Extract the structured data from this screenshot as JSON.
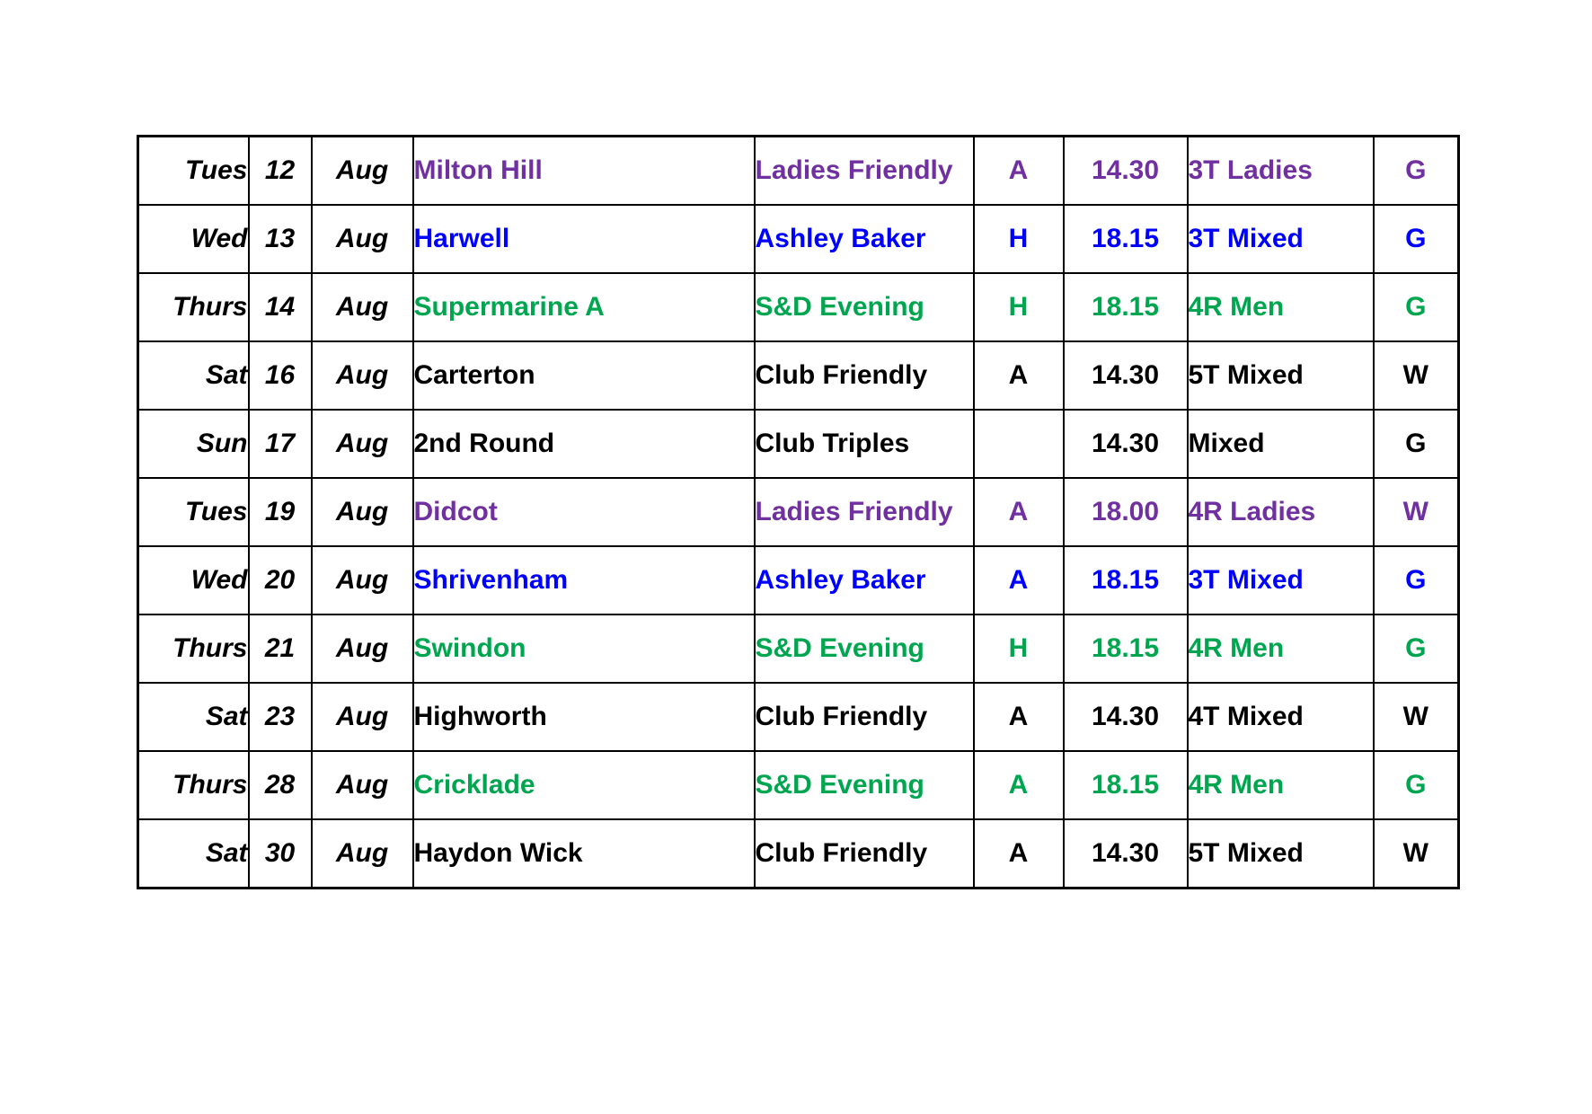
{
  "document": {
    "kind": "fixtures-table",
    "background": "#FFFFFF"
  },
  "palette": {
    "purple": "#7030A0",
    "blue": "#0000FF",
    "green": "#00A64F",
    "black": "#000000",
    "border": "#000000"
  },
  "table": {
    "columns": [
      {
        "key": "day",
        "name": "day"
      },
      {
        "key": "date",
        "name": "date"
      },
      {
        "key": "month",
        "name": "month"
      },
      {
        "key": "opponent",
        "name": "opponent"
      },
      {
        "key": "event",
        "name": "event"
      },
      {
        "key": "venue",
        "name": "home-or-away"
      },
      {
        "key": "time",
        "name": "start-time"
      },
      {
        "key": "format",
        "name": "format"
      },
      {
        "key": "gw",
        "name": "green-or-white"
      }
    ],
    "rows": [
      {
        "color": "purple",
        "day": "Tues",
        "date": "12",
        "month": "Aug",
        "opponent": "Milton Hill",
        "event": "Ladies Friendly",
        "venue": "A",
        "time": "14.30",
        "format": "3T Ladies",
        "gw": "G"
      },
      {
        "color": "blue",
        "day": "Wed",
        "date": "13",
        "month": "Aug",
        "opponent": "Harwell",
        "event": "Ashley Baker",
        "venue": "H",
        "time": "18.15",
        "format": "3T Mixed",
        "gw": "G"
      },
      {
        "color": "green",
        "day": "Thurs",
        "date": "14",
        "month": "Aug",
        "opponent": "Supermarine A",
        "event": "S&D Evening",
        "venue": "H",
        "time": "18.15",
        "format": "4R Men",
        "gw": "G"
      },
      {
        "color": "black",
        "day": "Sat",
        "date": "16",
        "month": "Aug",
        "opponent": "Carterton",
        "event": "Club Friendly",
        "venue": "A",
        "time": "14.30",
        "format": "5T Mixed",
        "gw": "W"
      },
      {
        "color": "black",
        "day": "Sun",
        "date": "17",
        "month": "Aug",
        "opponent": "2nd Round",
        "event": "Club Triples",
        "venue": "",
        "time": "14.30",
        "format": "Mixed",
        "gw": "G"
      },
      {
        "color": "purple",
        "day": "Tues",
        "date": "19",
        "month": "Aug",
        "opponent": "Didcot",
        "event": "Ladies Friendly",
        "venue": "A",
        "time": "18.00",
        "format": "4R Ladies",
        "gw": "W"
      },
      {
        "color": "blue",
        "day": "Wed",
        "date": "20",
        "month": "Aug",
        "opponent": "Shrivenham",
        "event": "Ashley Baker",
        "venue": "A",
        "time": "18.15",
        "format": "3T Mixed",
        "gw": "G"
      },
      {
        "color": "green",
        "day": "Thurs",
        "date": "21",
        "month": "Aug",
        "opponent": "Swindon",
        "event": "S&D Evening",
        "venue": "H",
        "time": "18.15",
        "format": "4R Men",
        "gw": "G"
      },
      {
        "color": "black",
        "day": "Sat",
        "date": "23",
        "month": "Aug",
        "opponent": "Highworth",
        "event": "Club Friendly",
        "venue": "A",
        "time": "14.30",
        "format": "4T Mixed",
        "gw": "W"
      },
      {
        "color": "green",
        "day": "Thurs",
        "date": "28",
        "month": "Aug",
        "opponent": "Cricklade",
        "event": "S&D Evening",
        "venue": "A",
        "time": "18.15",
        "format": "4R Men",
        "gw": "G"
      },
      {
        "color": "black",
        "day": "Sat",
        "date": "30",
        "month": "Aug",
        "opponent": "Haydon Wick",
        "event": "Club Friendly",
        "venue": "A",
        "time": "14.30",
        "format": "5T Mixed",
        "gw": "W"
      }
    ]
  }
}
